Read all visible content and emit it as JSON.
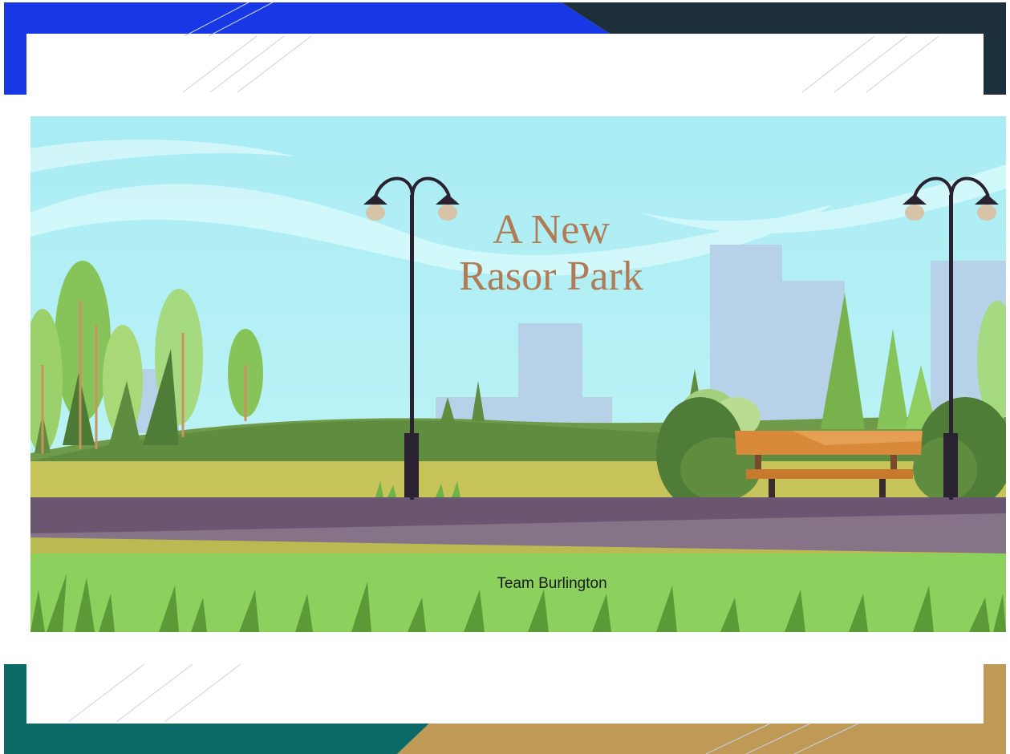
{
  "slide": {
    "title_line1": "A New",
    "title_line2": "Rasor Park",
    "subtitle": "Team Burlington"
  },
  "colors": {
    "title": "#b07b55",
    "frame_top_left": "#1838e6",
    "frame_top_right": "#1e2f3c",
    "frame_bottom_left": "#0b6a66",
    "frame_bottom_right": "#bf9a56",
    "sky": "#aef1f5",
    "grass": "#8cd05e",
    "path": "#6a5670"
  },
  "decorations": {
    "frame": "geometric-frame",
    "illustration": "park-illustration",
    "icons": [
      "street-lamp-icon",
      "bench-icon",
      "tree-icon",
      "bush-icon",
      "building-icon",
      "grass-icon"
    ]
  }
}
